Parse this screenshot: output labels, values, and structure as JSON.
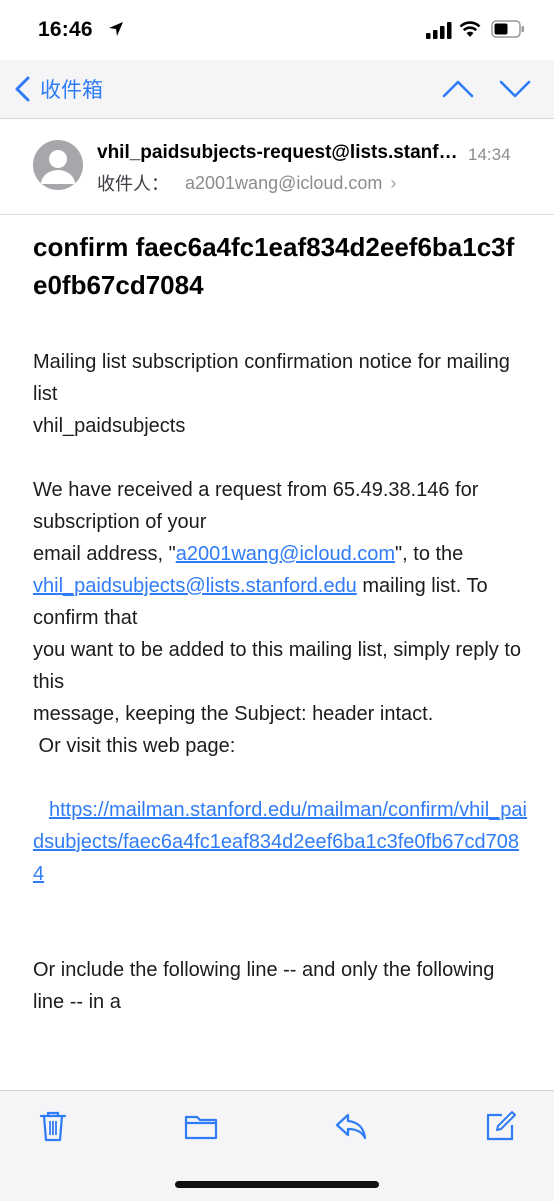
{
  "status_bar": {
    "time": "16:46",
    "icons": [
      "location-arrow-icon",
      "cellular-signal-icon",
      "wifi-icon",
      "battery-icon"
    ]
  },
  "nav": {
    "back_label": "收件箱",
    "icons": [
      "chevron-left-icon",
      "chevron-up-icon",
      "chevron-down-icon"
    ],
    "accent_color": "#2f7cf6"
  },
  "message": {
    "sender": "vhil_paidsubjects-request@lists.stanford.edu",
    "time": "14:34",
    "recipient_label": "收件人：",
    "recipient": "a2001wang@icloud.com",
    "subject": "confirm faec6a4fc1eaf834d2eef6ba1c3fe0fb67cd7084",
    "body": {
      "p1_line1": "Mailing list subscription confirmation notice for mailing list",
      "p1_line2": "vhil_paidsubjects",
      "p2_line1": "We have received a request from 65.49.38.146 for subscription of your",
      "p2_line2_pre": "email address, \"",
      "p2_email_link": "a2001wang@icloud.com",
      "p2_line2_post": "\", to the",
      "p2_list_link": "vhil_paidsubjects@lists.stanford.edu",
      "p2_line3_post": " mailing list.  To confirm that",
      "p2_line4": "you want to be added to this mailing list, simply reply to this",
      "p2_line5": "message, keeping the Subject: header intact.",
      "p2_line6": " Or visit this web page:",
      "confirm_url": "https://mailman.stanford.edu/mailman/confirm/vhil_paidsubjects/faec6a4fc1eaf834d2eef6ba1c3fe0fb67cd7084",
      "p3_line1": "Or include the following line -- and only the following line -- in a"
    }
  },
  "toolbar": {
    "icons": [
      "trash-icon",
      "folder-icon",
      "reply-icon",
      "compose-icon"
    ]
  }
}
